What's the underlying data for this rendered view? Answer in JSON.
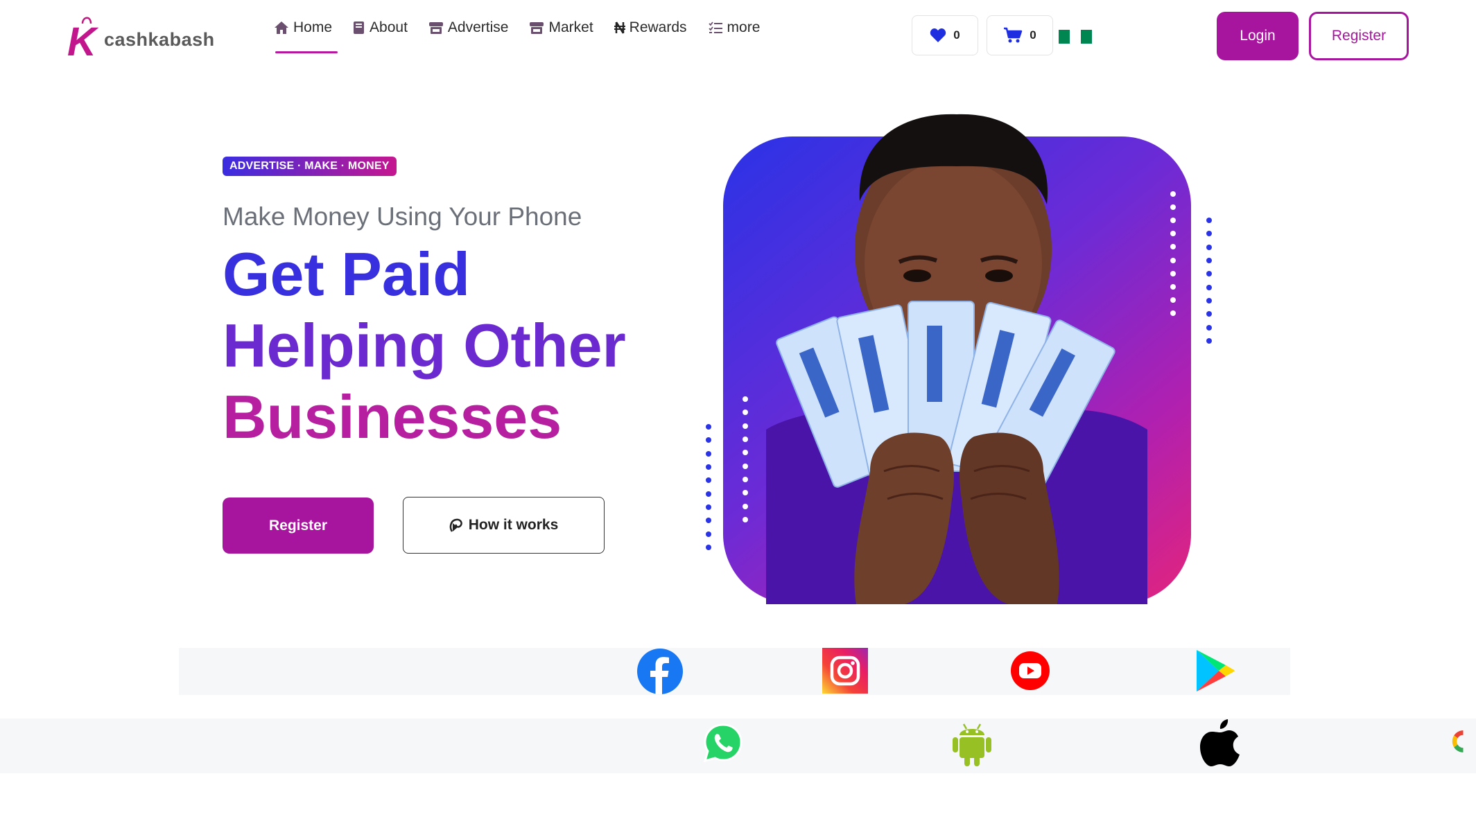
{
  "brand": {
    "name": "cashkabash",
    "logo_letter": "K"
  },
  "nav": {
    "items": [
      {
        "label": "Home",
        "icon": "home-icon",
        "active": true
      },
      {
        "label": "About",
        "icon": "book-icon",
        "active": false
      },
      {
        "label": "Advertise",
        "icon": "store-icon",
        "active": false
      },
      {
        "label": "Market",
        "icon": "shop-icon",
        "active": false
      },
      {
        "label": "Rewards",
        "icon": "naira-icon",
        "active": false
      },
      {
        "label": "more",
        "icon": "list-icon",
        "active": false
      }
    ]
  },
  "header": {
    "wishlist_count": "0",
    "cart_count": "0",
    "login_label": "Login",
    "register_label": "Register"
  },
  "hero": {
    "badge": "ADVERTISE · MAKE · MONEY",
    "subtitle": "Make Money Using Your Phone",
    "headline_lines": [
      "Get Paid",
      "Helping Other",
      "Businesses"
    ],
    "register_label": "Register",
    "how_label": "How it works"
  },
  "logos_row1": [
    "facebook-icon",
    "instagram-icon",
    "youtube-icon",
    "google-play-icon"
  ],
  "logos_row2": [
    "whatsapp-icon",
    "android-icon",
    "apple-icon",
    "google-icon"
  ],
  "colors": {
    "brand_purple": "#a7159e",
    "headline_blue": "#3830df",
    "headline_violet": "#6a2ad0",
    "headline_magenta": "#b61f9f",
    "flag_green": "#008751"
  }
}
